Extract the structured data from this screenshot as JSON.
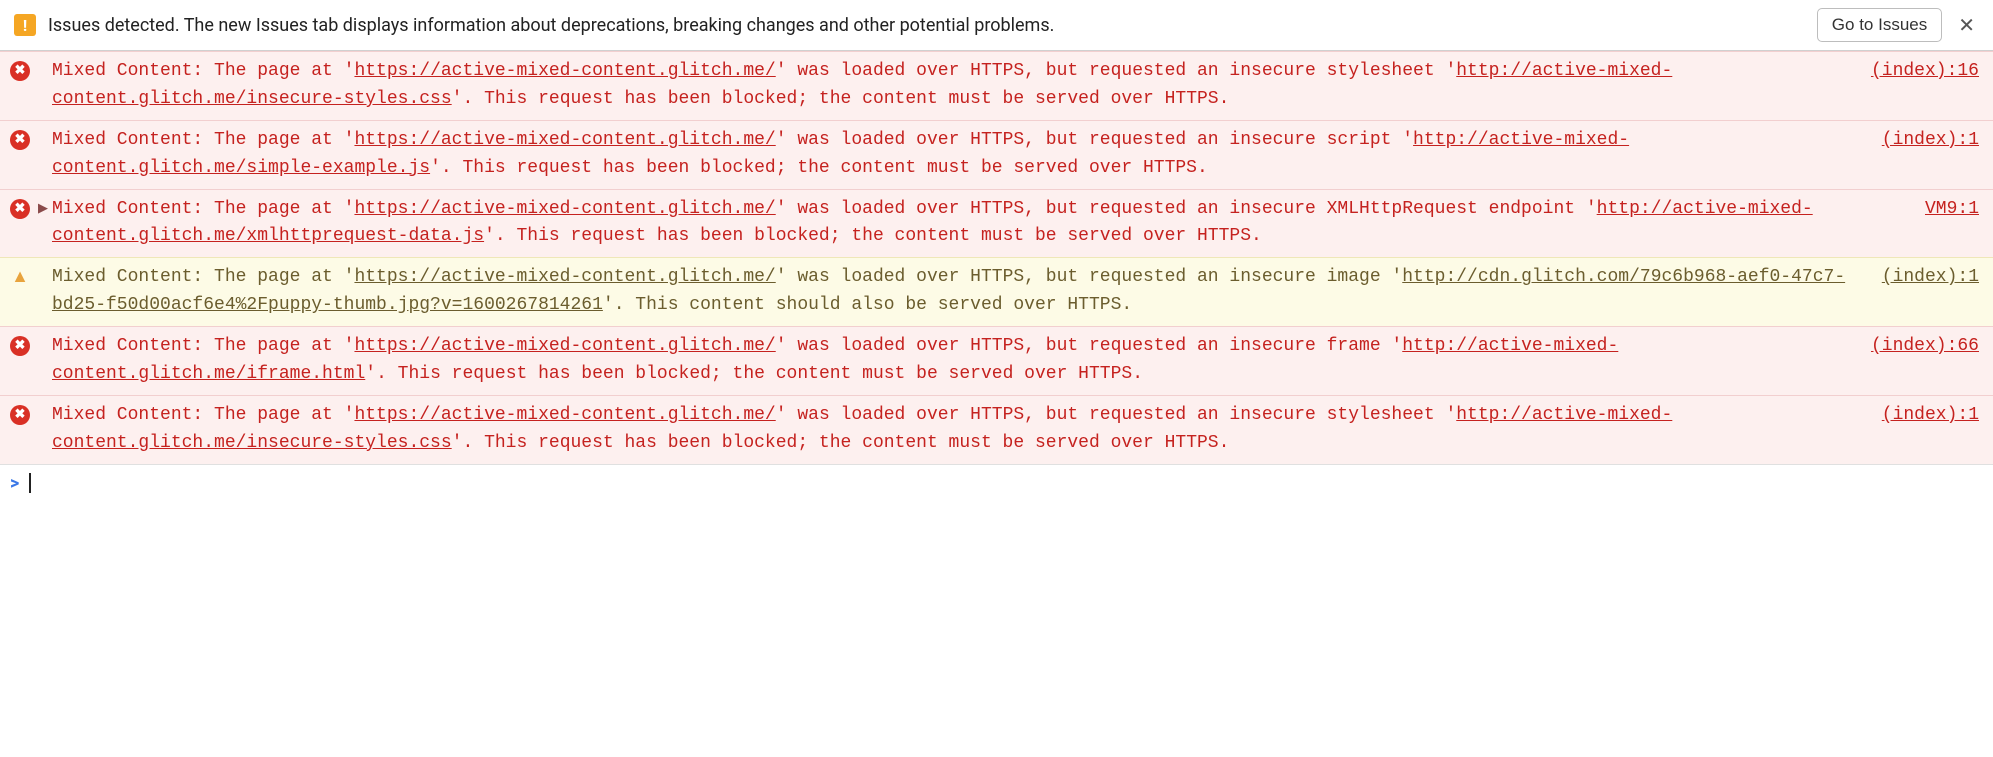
{
  "infobar": {
    "text": "Issues detected. The new Issues tab displays information about deprecations, breaking changes and other potential problems.",
    "button": "Go to Issues",
    "close_glyph": "✕",
    "icon_glyph": "!"
  },
  "messages": [
    {
      "level": "error",
      "expandable": false,
      "source": "(index):16",
      "pre1": "Mixed Content: The page at '",
      "url1": "https://active-mixed-content.glitch.me/",
      "mid": "' was loaded over HTTPS, but requested an insecure stylesheet '",
      "url2": "http://active-mixed-content.glitch.me/insecure-styles.css",
      "post": "'. This request has been blocked; the content must be served over HTTPS."
    },
    {
      "level": "error",
      "expandable": false,
      "source": "(index):1",
      "pre1": "Mixed Content: The page at '",
      "url1": "https://active-mixed-content.glitch.me/",
      "mid": "' was loaded over HTTPS, but requested an insecure script '",
      "url2": "http://active-mixed-content.glitch.me/simple-example.js",
      "post": "'. This request has been blocked; the content must be served over HTTPS."
    },
    {
      "level": "error",
      "expandable": true,
      "source": "VM9:1",
      "pre1": "Mixed Content: The page at '",
      "url1": "https://active-mixed-content.glitch.me/",
      "mid": "' was loaded over HTTPS, but requested an insecure XMLHttpRequest endpoint '",
      "url2": "http://active-mixed-content.glitch.me/xmlhttprequest-data.js",
      "post": "'. This request has been blocked; the content must be served over HTTPS."
    },
    {
      "level": "warn",
      "expandable": false,
      "source": "(index):1",
      "pre1": "Mixed Content: The page at '",
      "url1": "https://active-mixed-content.glitch.me/",
      "mid": "' was loaded over HTTPS, but requested an insecure image '",
      "url2": "http://cdn.glitch.com/79c6b968-aef0-47c7-bd25-f50d00acf6e4%2Fpuppy-thumb.jpg?v=1600267814261",
      "post": "'. This content should also be served over HTTPS."
    },
    {
      "level": "error",
      "expandable": false,
      "source": "(index):66",
      "pre1": "Mixed Content: The page at '",
      "url1": "https://active-mixed-content.glitch.me/",
      "mid": "' was loaded over HTTPS, but requested an insecure frame '",
      "url2": "http://active-mixed-content.glitch.me/iframe.html",
      "post": "'. This request has been blocked; the content must be served over HTTPS."
    },
    {
      "level": "error",
      "expandable": false,
      "source": "(index):1",
      "pre1": "Mixed Content: The page at '",
      "url1": "https://active-mixed-content.glitch.me/",
      "mid": "' was loaded over HTTPS, but requested an insecure stylesheet '",
      "url2": "http://active-mixed-content.glitch.me/insecure-styles.css",
      "post": "'. This request has been blocked; the content must be served over HTTPS."
    }
  ],
  "icons": {
    "error_glyph": "✖",
    "warn_glyph": "▲",
    "caret_glyph": "▶"
  },
  "prompt": {
    "caret": ">"
  }
}
